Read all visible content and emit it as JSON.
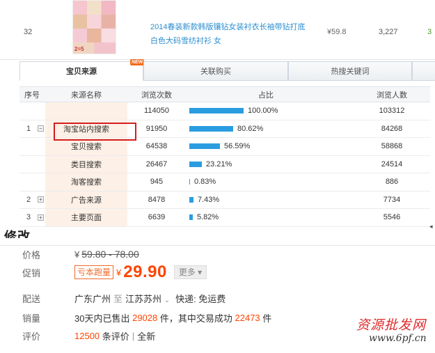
{
  "product_row": {
    "index": "32",
    "thumb_tag": "2=5",
    "title": "2014春装新款韩版镶钻女装衬衣长袖带钻打底白色大码雪纺衬衫 女",
    "price": "¥59.8",
    "sales": "3,227",
    "extra": "3"
  },
  "tabs": [
    {
      "label": "宝贝来源",
      "active": true,
      "badge": "NEW"
    },
    {
      "label": "关联购买",
      "active": false
    },
    {
      "label": "热搜关键词",
      "active": false
    },
    {
      "label": "",
      "active": false
    }
  ],
  "table": {
    "headers": {
      "index": "序号",
      "source": "来源名称",
      "views": "浏览次数",
      "share": "占比",
      "visitors": "浏览人数"
    },
    "rows": [
      {
        "index": "",
        "toggle": "",
        "source": "",
        "views": "114050",
        "share_pct": 100.0,
        "share": "100.00%",
        "visitors": "103312"
      },
      {
        "index": "1",
        "toggle": "−",
        "source": "淘宝站内搜索",
        "views": "91950",
        "share_pct": 80.62,
        "share": "80.62%",
        "visitors": "84268"
      },
      {
        "index": "",
        "toggle": "",
        "source": "宝贝搜索",
        "views": "64538",
        "share_pct": 56.59,
        "share": "56.59%",
        "visitors": "58868"
      },
      {
        "index": "",
        "toggle": "",
        "source": "类目搜索",
        "views": "26467",
        "share_pct": 23.21,
        "share": "23.21%",
        "visitors": "24514"
      },
      {
        "index": "",
        "toggle": "",
        "source": "淘客搜索",
        "views": "945",
        "share_pct": 0.83,
        "share": "0.83%",
        "visitors": "886"
      },
      {
        "index": "2",
        "toggle": "+",
        "source": "广告来源",
        "views": "8478",
        "share_pct": 7.43,
        "share": "7.43%",
        "visitors": "7734"
      },
      {
        "index": "3",
        "toggle": "+",
        "source": "主要页面",
        "views": "6639",
        "share_pct": 5.82,
        "share": "5.82%",
        "visitors": "5546"
      }
    ]
  },
  "detail": {
    "partial_heading": "修改",
    "price_label": "价格",
    "price_yen": "¥",
    "price_range": "59.80 - 78.00",
    "promo_label": "促销",
    "promo_tag": "亏本跑量",
    "promo_yen": "¥",
    "promo_price": "29.90",
    "more": "更多",
    "shipping_label": "配送",
    "ship_from": "广东广州",
    "ship_to_word": "至",
    "ship_to": "江苏苏州",
    "ship_method": "快递: 免运费",
    "sales_label": "销量",
    "sales_prefix": "30天内已售出",
    "sales_count": "29028",
    "sales_mid": "件，其中交易成功",
    "sales_success": "22473",
    "sales_suffix": "件",
    "review_label": "评价",
    "review_count": "12500",
    "review_suffix": "条评价",
    "review_flag": "全新"
  },
  "watermark": {
    "text": "资源批发网",
    "url": "www.6pf.cn"
  },
  "colors": {
    "accent_blue": "#2a9de0",
    "price_orange": "#ff4400",
    "highlight_red": "#d51d1d",
    "source_bg": "#fdf0e6"
  }
}
